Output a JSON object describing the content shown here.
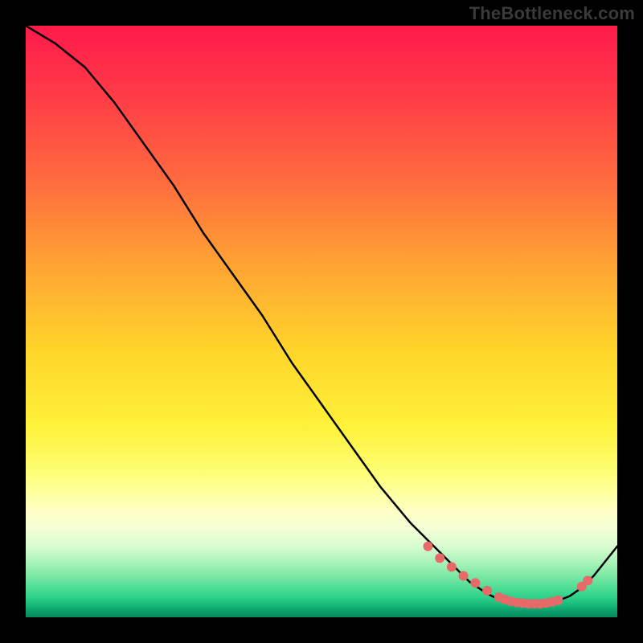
{
  "watermark": "TheBottleneck.com",
  "chart_data": {
    "type": "line",
    "title": "",
    "xlabel": "",
    "ylabel": "",
    "xlim": [
      0,
      100
    ],
    "ylim": [
      0,
      100
    ],
    "series": [
      {
        "name": "curve",
        "x": [
          0,
          5,
          10,
          15,
          20,
          25,
          30,
          35,
          40,
          45,
          50,
          55,
          60,
          65,
          70,
          72,
          75,
          78,
          80,
          82,
          85,
          88,
          90,
          92,
          94,
          96,
          98,
          100
        ],
        "y": [
          100,
          97,
          93,
          87,
          80,
          73,
          65,
          58,
          51,
          43,
          36,
          29,
          22,
          16,
          11,
          9,
          6,
          4,
          3,
          2.5,
          2.2,
          2.3,
          2.8,
          3.6,
          5,
          7,
          9.5,
          12
        ]
      }
    ],
    "marker_points": {
      "name": "highlights",
      "x": [
        68,
        70,
        72,
        74,
        76,
        78,
        80,
        81,
        82,
        83,
        84,
        85,
        86,
        87,
        88,
        89,
        90,
        94,
        95
      ],
      "y": [
        12,
        10,
        8.5,
        7,
        5.8,
        4.5,
        3.4,
        3.0,
        2.7,
        2.5,
        2.4,
        2.3,
        2.3,
        2.3,
        2.4,
        2.6,
        2.9,
        5.2,
        6.2
      ]
    },
    "gradient_stops": [
      {
        "pos": 0.0,
        "color": "#ff1a4b"
      },
      {
        "pos": 0.55,
        "color": "#ffd52a"
      },
      {
        "pos": 0.82,
        "color": "#feffc4"
      },
      {
        "pos": 0.96,
        "color": "#2fd38b"
      },
      {
        "pos": 1.0,
        "color": "#05885b"
      }
    ]
  }
}
